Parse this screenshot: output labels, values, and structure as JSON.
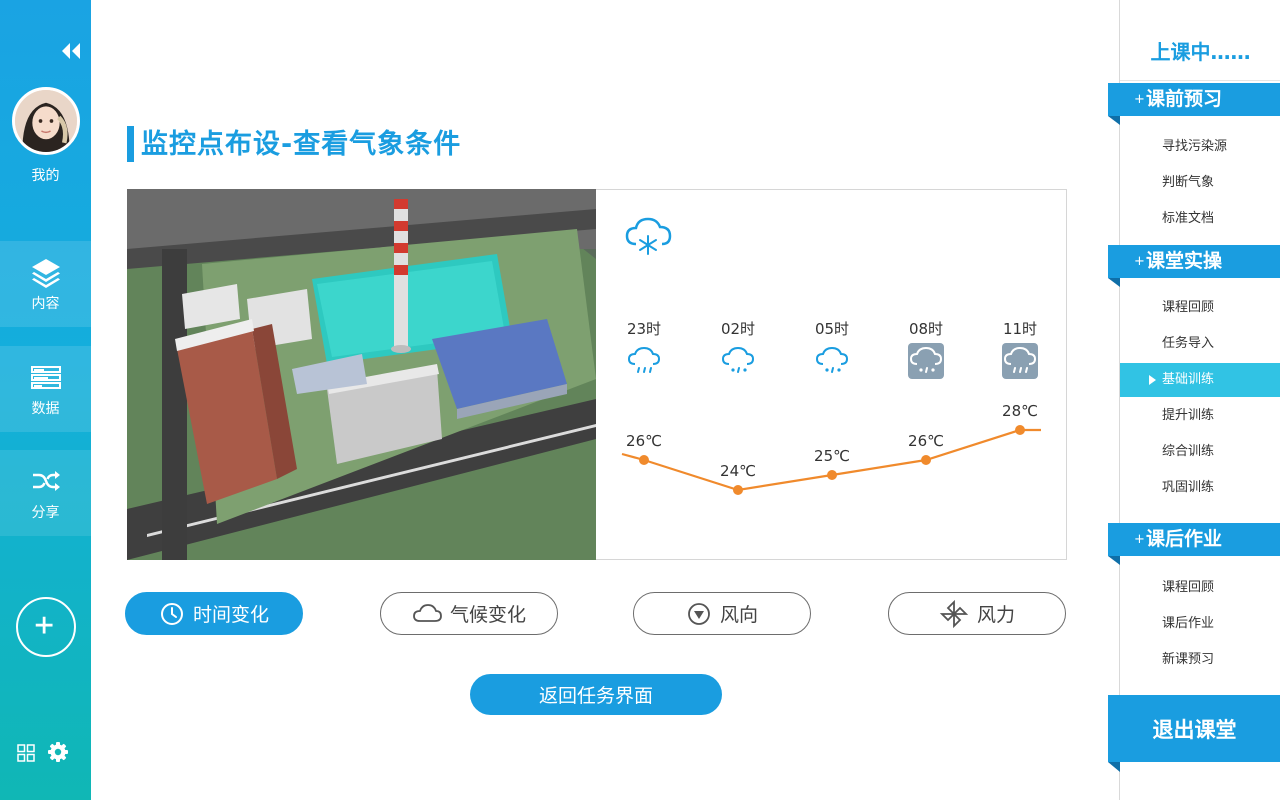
{
  "sidebar": {
    "profile_label": "我的",
    "nav": [
      {
        "label": "内容",
        "icon": "layers-icon"
      },
      {
        "label": "数据",
        "icon": "data-icon"
      },
      {
        "label": "分享",
        "icon": "shuffle-icon"
      }
    ],
    "bottom_icons": [
      "grid-icon",
      "gear-icon"
    ]
  },
  "main": {
    "title": "监控点布设-查看气象条件",
    "current_weather_icon": "snow-cloud-icon",
    "forecast": [
      {
        "hour": "23时",
        "temp": "26℃",
        "temp_value": 26,
        "icon": "rain-cloud-icon"
      },
      {
        "hour": "02时",
        "temp": "24℃",
        "temp_value": 24,
        "icon": "sleet-cloud-icon"
      },
      {
        "hour": "05时",
        "temp": "25℃",
        "temp_value": 25,
        "icon": "sleet-cloud-icon"
      },
      {
        "hour": "08时",
        "temp": "26℃",
        "temp_value": 26,
        "icon": "sleet-cloud-icon"
      },
      {
        "hour": "11时",
        "temp": "28℃",
        "temp_value": 28,
        "icon": "rain-cloud-icon"
      }
    ],
    "tabs": [
      {
        "label": "时间变化",
        "icon": "clock-icon",
        "active": true
      },
      {
        "label": "气候变化",
        "icon": "cloud-icon",
        "active": false
      },
      {
        "label": "风向",
        "icon": "compass-icon",
        "active": false
      },
      {
        "label": "风力",
        "icon": "windmill-icon",
        "active": false
      }
    ],
    "return_label": "返回任务界面"
  },
  "right": {
    "status": "上课中……",
    "sections": [
      {
        "title": "课前预习",
        "items": [
          "寻找污染源",
          "判断气象",
          "标准文档"
        ]
      },
      {
        "title": "课堂实操",
        "items": [
          "课程回顾",
          "任务导入",
          "基础训练",
          "提升训练",
          "综合训练",
          "巩固训练"
        ]
      },
      {
        "title": "课后作业",
        "items": [
          "课程回顾",
          "课后作业",
          "新课预习"
        ]
      }
    ],
    "active_item": "基础训练",
    "exit_label": "退出课堂"
  },
  "colors": {
    "primary": "#1a9de0",
    "accent_line": "#f08a2c",
    "active_item": "#31c3e4"
  }
}
